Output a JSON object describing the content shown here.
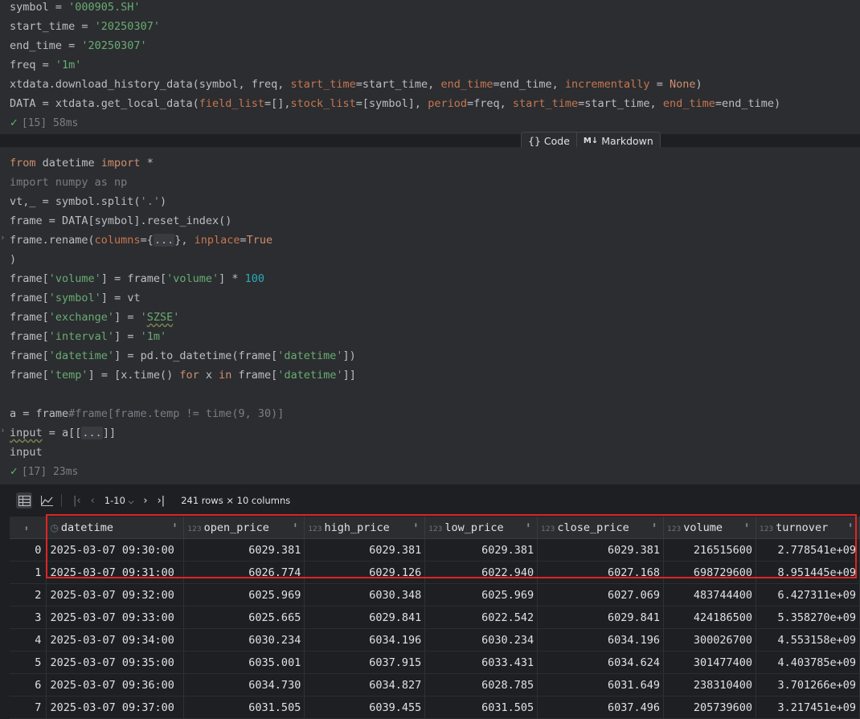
{
  "cell1": {
    "lines": [
      [
        {
          "t": "symbol = "
        },
        {
          "t": "'000905.SH'",
          "c": "str"
        }
      ],
      [
        {
          "t": "start_time = "
        },
        {
          "t": "'20250307'",
          "c": "str"
        }
      ],
      [
        {
          "t": "end_time = "
        },
        {
          "t": "'20250307'",
          "c": "str"
        }
      ],
      [
        {
          "t": "freq = "
        },
        {
          "t": "'1m'",
          "c": "str"
        }
      ],
      [
        {
          "t": "xtdata.download_history_data(symbol, freq, "
        },
        {
          "t": "start_time",
          "c": "parm2"
        },
        {
          "t": "=start_time, "
        },
        {
          "t": "end_time",
          "c": "parm2"
        },
        {
          "t": "=end_time, "
        },
        {
          "t": "incrementally",
          "c": "parm2"
        },
        {
          "t": " = "
        },
        {
          "t": "None",
          "c": "kw"
        },
        {
          "t": ")"
        }
      ],
      [
        {
          "t": "DATA = xtdata.get_local_data("
        },
        {
          "t": "field_list",
          "c": "parm2"
        },
        {
          "t": "=[],"
        },
        {
          "t": "stock_list",
          "c": "parm2"
        },
        {
          "t": "=[symbol], "
        },
        {
          "t": "period",
          "c": "parm2"
        },
        {
          "t": "=freq, "
        },
        {
          "t": "start_time",
          "c": "parm2"
        },
        {
          "t": "=start_time, "
        },
        {
          "t": "end_time",
          "c": "parm2"
        },
        {
          "t": "=end_time)"
        }
      ]
    ],
    "status": "[15] 58ms"
  },
  "insert": {
    "code_label": "Code",
    "markdown_label": "Markdown"
  },
  "cell2": {
    "lines": [
      [
        {
          "t": "from",
          "c": "kw"
        },
        {
          "t": " datetime "
        },
        {
          "t": "import",
          "c": "kw"
        },
        {
          "t": " *"
        }
      ],
      [
        {
          "t": "import numpy as np",
          "c": "cmt"
        }
      ],
      [
        {
          "t": "vt,_ = symbol.split("
        },
        {
          "t": "'.'",
          "c": "str"
        },
        {
          "t": ")"
        }
      ],
      [
        {
          "t": "frame = DATA[symbol].reset_index()"
        }
      ],
      [
        {
          "t": "frame.rename("
        },
        {
          "t": "columns",
          "c": "parm2"
        },
        {
          "t": "={"
        },
        {
          "t": "...",
          "c": "fold"
        },
        {
          "t": "}, "
        },
        {
          "t": "inplace",
          "c": "parm2"
        },
        {
          "t": "="
        },
        {
          "t": "True",
          "c": "kw"
        }
      ],
      [
        {
          "t": ")"
        }
      ],
      [
        {
          "t": "frame["
        },
        {
          "t": "'volume'",
          "c": "str"
        },
        {
          "t": "] = frame["
        },
        {
          "t": "'volume'",
          "c": "str"
        },
        {
          "t": "] * "
        },
        {
          "t": "100",
          "c": "num"
        }
      ],
      [
        {
          "t": "frame["
        },
        {
          "t": "'symbol'",
          "c": "str"
        },
        {
          "t": "] = vt"
        }
      ],
      [
        {
          "t": "frame["
        },
        {
          "t": "'exchange'",
          "c": "str"
        },
        {
          "t": "] = "
        },
        {
          "t": "'",
          "c": "str"
        },
        {
          "t": "SZSE",
          "c": "str wave"
        },
        {
          "t": "'",
          "c": "str"
        }
      ],
      [
        {
          "t": "frame["
        },
        {
          "t": "'interval'",
          "c": "str"
        },
        {
          "t": "] = "
        },
        {
          "t": "'1m'",
          "c": "str"
        }
      ],
      [
        {
          "t": "frame["
        },
        {
          "t": "'datetime'",
          "c": "str"
        },
        {
          "t": "] = pd.to_datetime(frame["
        },
        {
          "t": "'datetime'",
          "c": "str"
        },
        {
          "t": "])"
        }
      ],
      [
        {
          "t": "frame["
        },
        {
          "t": "'temp'",
          "c": "str"
        },
        {
          "t": "] = [x.time() "
        },
        {
          "t": "for",
          "c": "kw"
        },
        {
          "t": " x "
        },
        {
          "t": "in",
          "c": "kw"
        },
        {
          "t": " frame["
        },
        {
          "t": "'datetime'",
          "c": "str"
        },
        {
          "t": "]]"
        }
      ],
      [
        {
          "t": ""
        }
      ],
      [
        {
          "t": "a = frame"
        },
        {
          "t": "#frame[frame.temp != time(9, 30)]",
          "c": "cmt"
        }
      ],
      [
        {
          "t": "input",
          "c": "wave"
        },
        {
          "t": " = a[["
        },
        {
          "t": "...",
          "c": "fold"
        },
        {
          "t": "]]"
        }
      ],
      [
        {
          "t": "input"
        }
      ]
    ],
    "status": "[17] 23ms"
  },
  "output": {
    "pager_label": "1-10",
    "rows_info": "241 rows × 10 columns",
    "columns": [
      {
        "name": "datetime",
        "type": "clock"
      },
      {
        "name": "open_price",
        "type": "123"
      },
      {
        "name": "high_price",
        "type": "123"
      },
      {
        "name": "low_price",
        "type": "123"
      },
      {
        "name": "close_price",
        "type": "123"
      },
      {
        "name": "volume",
        "type": "123"
      },
      {
        "name": "turnover",
        "type": "123"
      }
    ],
    "rows": [
      [
        "0",
        "2025-03-07 09:30:00",
        "6029.381",
        "6029.381",
        "6029.381",
        "6029.381",
        "216515600",
        "2.778541e+09"
      ],
      [
        "1",
        "2025-03-07 09:31:00",
        "6026.774",
        "6029.126",
        "6022.940",
        "6027.168",
        "698729600",
        "8.951445e+09"
      ],
      [
        "2",
        "2025-03-07 09:32:00",
        "6025.969",
        "6030.348",
        "6025.969",
        "6027.069",
        "483744400",
        "6.427311e+09"
      ],
      [
        "3",
        "2025-03-07 09:33:00",
        "6025.665",
        "6029.841",
        "6022.542",
        "6029.841",
        "424186500",
        "5.358270e+09"
      ],
      [
        "4",
        "2025-03-07 09:34:00",
        "6030.234",
        "6034.196",
        "6030.234",
        "6034.196",
        "300026700",
        "4.553158e+09"
      ],
      [
        "5",
        "2025-03-07 09:35:00",
        "6035.001",
        "6037.915",
        "6033.431",
        "6034.624",
        "301477400",
        "4.403785e+09"
      ],
      [
        "6",
        "2025-03-07 09:36:00",
        "6034.730",
        "6034.827",
        "6028.785",
        "6031.649",
        "238310400",
        "3.701266e+09"
      ],
      [
        "7",
        "2025-03-07 09:37:00",
        "6031.505",
        "6039.455",
        "6031.505",
        "6037.496",
        "205739600",
        "3.217451e+09"
      ]
    ]
  },
  "colors": {
    "highlight": "#e02424",
    "check": "#5fb865"
  }
}
